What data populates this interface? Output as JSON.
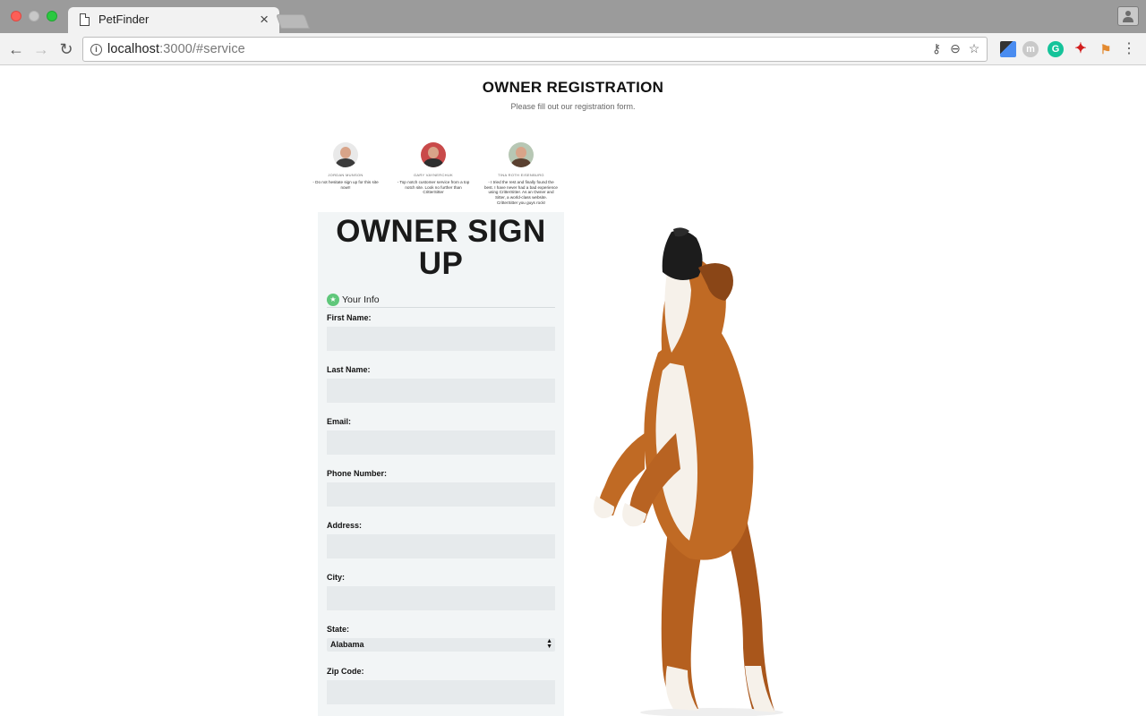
{
  "browser": {
    "tab_title": "PetFinder",
    "tab_close": "×",
    "url_host": "localhost",
    "url_path": ":3000/#service",
    "info_glyph": "i"
  },
  "header": {
    "title": "OWNER REGISTRATION",
    "subtitle": "Please fill out our registration form."
  },
  "testimonials": [
    {
      "name": "JORDAN MUNSON",
      "quote": "- Do not hesitate sign up for this site now!!",
      "avatar_color": "#3b3b3b"
    },
    {
      "name": "GARY VAYNERCHUK",
      "quote": "- Top notch customer service from a top notch site. Look no further than CritterSitter",
      "avatar_color": "#2e2e2e"
    },
    {
      "name": "TINA ROTH EISENBURG",
      "quote": "- I tried the rest and finally found the best. I have never had a bad experience using CritterSitter. As an Owner and Sitter, a world-class website. CritterSitter you guys rock!",
      "avatar_color": "#5a4030"
    }
  ],
  "form": {
    "heading": "OWNER SIGN UP",
    "section_label": "Your Info",
    "section_icon": "★",
    "fields": {
      "first_name": "First Name:",
      "last_name": "Last Name:",
      "email": "Email:",
      "phone": "Phone Number:",
      "address": "Address:",
      "city": "City:",
      "state": "State:",
      "zip": "Zip Code:"
    },
    "state_selected": "Alabama"
  },
  "colors": {
    "accent_green": "#5fc77a",
    "card_bg": "#f2f5f6",
    "input_bg": "#e6eaec"
  }
}
